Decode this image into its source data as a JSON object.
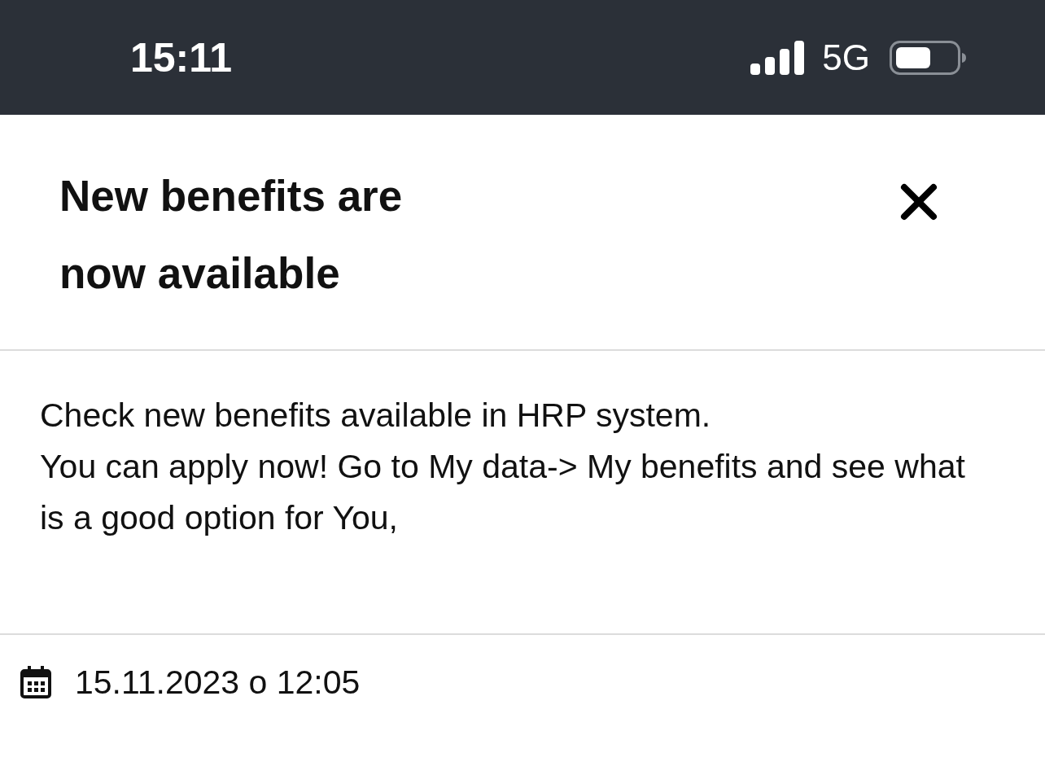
{
  "status_bar": {
    "time": "15:11",
    "network": "5G"
  },
  "notification": {
    "title": "New benefits are now available",
    "body": [
      "Check new benefits available in HRP system.",
      "You can apply now! Go to My data-> My benefits and see what is a good option for You,"
    ],
    "date": "15.11.2023 o 12:05"
  }
}
